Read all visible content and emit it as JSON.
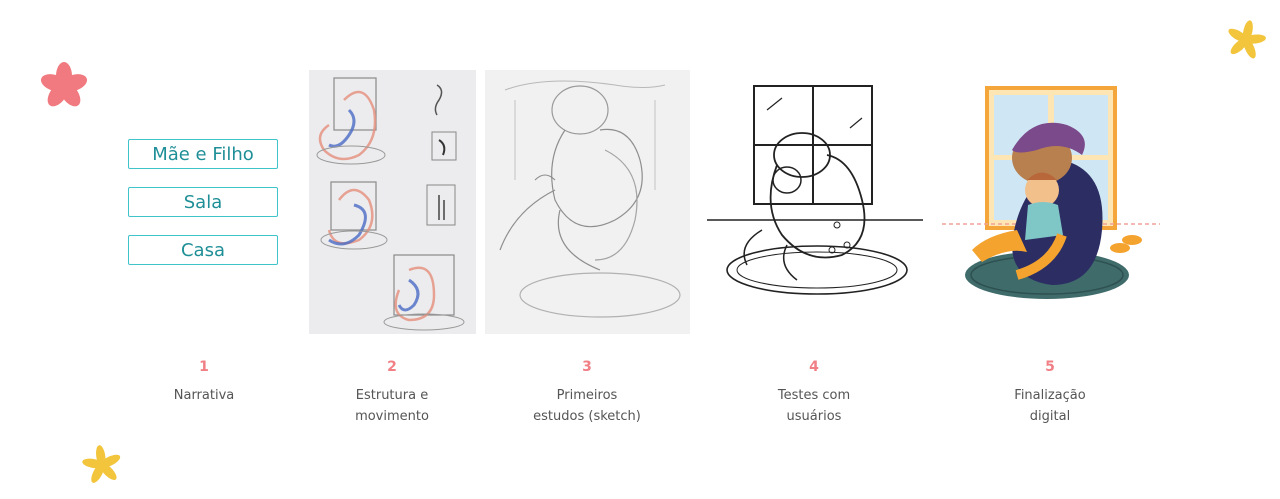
{
  "tags": [
    "Mãe e Filho",
    "Sala",
    "Casa"
  ],
  "steps": [
    {
      "number": "1",
      "label": "Narrativa"
    },
    {
      "number": "2",
      "label": "Estrutura e\nmovimento"
    },
    {
      "number": "3",
      "label": "Primeiros\nestudos (sketch)"
    },
    {
      "number": "4",
      "label": "Testes com\nusuários"
    },
    {
      "number": "5",
      "label": "Finalização\ndigital"
    }
  ],
  "colors": {
    "accent_pink": "#f07f86",
    "accent_teal": "#3fc4c9",
    "accent_yellow": "#f2c53d",
    "text_gray": "#555555"
  }
}
